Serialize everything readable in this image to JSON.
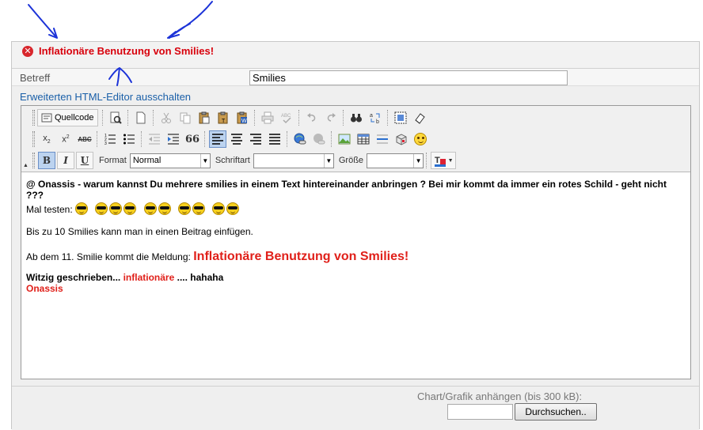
{
  "error": {
    "message": "Inflationäre Benutzung von Smilies!"
  },
  "subject": {
    "label": "Betreff",
    "value": "Smilies"
  },
  "editor_toggle": {
    "label": "Erweiterten HTML-Editor ausschalten"
  },
  "toolbar": {
    "source_label": "Quellcode",
    "format_label": "Format",
    "format_value": "Normal",
    "font_label": "Schriftart",
    "font_value": "",
    "size_label": "Größe",
    "size_value": "",
    "bold": "B",
    "italic": "I",
    "underline": "U",
    "quote": "66"
  },
  "content": {
    "line1": "@ Onassis - warum kannst Du mehrere smilies in einem Text hintereinander anbringen ? Bei mir kommt da immer ein rotes Schild - geht nicht ???",
    "line2_prefix": "Mal testen:",
    "smiley_count": 10,
    "line3": "Bis zu 10 Smilies kann man in einen Beitrag einfügen.",
    "line4_prefix": "Ab dem 11. Smilie kommt die Meldung:",
    "line4_highlight": "Inflationäre Benutzung von Smilies!",
    "line5_prefix": "Witzig geschrieben...",
    "line5_red": "inflationäre",
    "line5_suffix": ".... hahaha",
    "signature": "Onassis"
  },
  "attachment": {
    "label": "Chart/Grafik anhängen (bis 300 kB):",
    "browse_label": "Durchsuchen.."
  },
  "colors": {
    "error_red": "#d8000c",
    "link_blue": "#1a5fa8",
    "annotation_blue": "#1c33d8"
  }
}
